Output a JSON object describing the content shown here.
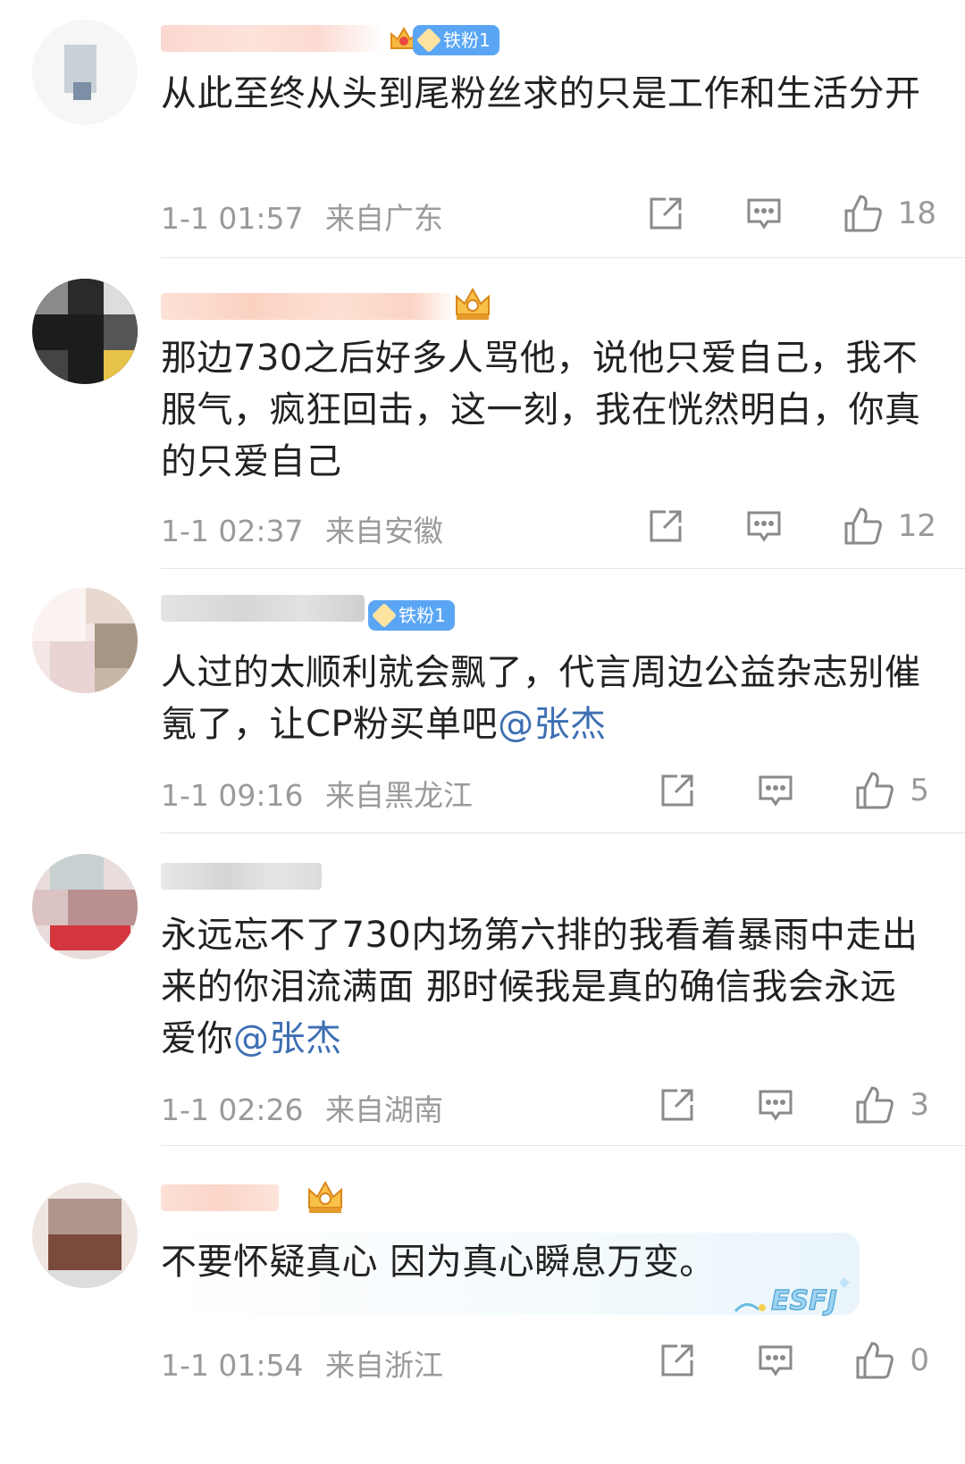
{
  "comments": [
    {
      "badge": "铁粉1",
      "text": "从此至终从头到尾粉丝求的只是工作和生活分开",
      "time": "1-1 01:57",
      "location": "来自广东",
      "likes": "18"
    },
    {
      "badge": "",
      "text": "那边730之后好多人骂他，说他只爱自己，我不服气，疯狂回击，这一刻，我在恍然明白，你真的只爱自己",
      "time": "1-1 02:37",
      "location": "来自安徽",
      "likes": "12"
    },
    {
      "badge": "铁粉1",
      "text_before": "人过的太顺利就会飘了，代言周边公益杂志别催氪了，让CP粉买单吧",
      "mention": "@张杰",
      "time": "1-1 09:16",
      "location": "来自黑龙江",
      "likes": "5"
    },
    {
      "badge": "",
      "text_before": "永远忘不了730内场第六排的我看着暴雨中走出来的你泪流满面 那时候我是真的确信我会永远爱你",
      "mention": "@张杰",
      "time": "1-1 02:26",
      "location": "来自湖南",
      "likes": "3"
    },
    {
      "badge": "",
      "text": "不要怀疑真心 因为真心瞬息万变。",
      "time": "1-1 01:54",
      "location": "来自浙江",
      "likes": "0"
    }
  ],
  "sticker_text": "ESFJ",
  "colors": {
    "mention": "#3d6fb3",
    "badge": "#5aa6f5",
    "meta": "#9a9a9a",
    "divider": "#e6e6e6"
  },
  "icons": [
    "share-icon",
    "comment-icon",
    "like-icon",
    "crown-icon",
    "diamond-badge-icon"
  ]
}
